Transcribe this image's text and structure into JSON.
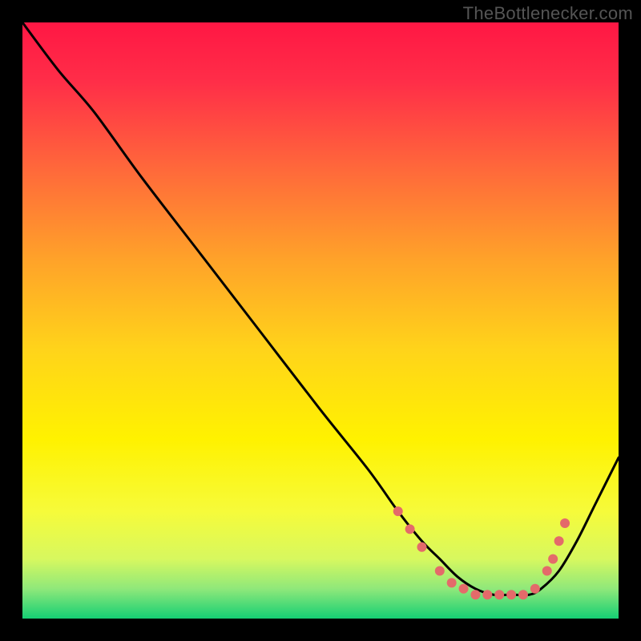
{
  "watermark": "TheBottlenecker.com",
  "chart_data": {
    "type": "line",
    "title": "",
    "xlabel": "",
    "ylabel": "",
    "xlim": [
      0,
      100
    ],
    "ylim": [
      0,
      100
    ],
    "background_gradient": {
      "type": "vertical",
      "stops": [
        {
          "offset": 0.0,
          "color": "#ff1744"
        },
        {
          "offset": 0.1,
          "color": "#ff2e48"
        },
        {
          "offset": 0.25,
          "color": "#ff6a3a"
        },
        {
          "offset": 0.4,
          "color": "#ffa329"
        },
        {
          "offset": 0.55,
          "color": "#ffd41a"
        },
        {
          "offset": 0.7,
          "color": "#fff200"
        },
        {
          "offset": 0.82,
          "color": "#f6fb3a"
        },
        {
          "offset": 0.9,
          "color": "#d7f85f"
        },
        {
          "offset": 0.95,
          "color": "#8fe87a"
        },
        {
          "offset": 1.0,
          "color": "#15cf74"
        }
      ]
    },
    "series": [
      {
        "name": "bottleneck-curve",
        "color": "#000000",
        "x": [
          0,
          6,
          12,
          20,
          30,
          40,
          50,
          58,
          63,
          67,
          70,
          73,
          76,
          79,
          82,
          85,
          87,
          90,
          93,
          96,
          100
        ],
        "y": [
          100,
          92,
          85,
          74,
          61,
          48,
          35,
          25,
          18,
          13,
          10,
          7,
          5,
          4,
          4,
          4,
          5,
          8,
          13,
          19,
          27
        ]
      }
    ],
    "markers": {
      "name": "highlight-dots",
      "color": "#e46a6a",
      "radius": 6,
      "points": [
        {
          "x": 63,
          "y": 18
        },
        {
          "x": 65,
          "y": 15
        },
        {
          "x": 67,
          "y": 12
        },
        {
          "x": 70,
          "y": 8
        },
        {
          "x": 72,
          "y": 6
        },
        {
          "x": 74,
          "y": 5
        },
        {
          "x": 76,
          "y": 4
        },
        {
          "x": 78,
          "y": 4
        },
        {
          "x": 80,
          "y": 4
        },
        {
          "x": 82,
          "y": 4
        },
        {
          "x": 84,
          "y": 4
        },
        {
          "x": 86,
          "y": 5
        },
        {
          "x": 88,
          "y": 8
        },
        {
          "x": 89,
          "y": 10
        },
        {
          "x": 90,
          "y": 13
        },
        {
          "x": 91,
          "y": 16
        }
      ]
    }
  }
}
